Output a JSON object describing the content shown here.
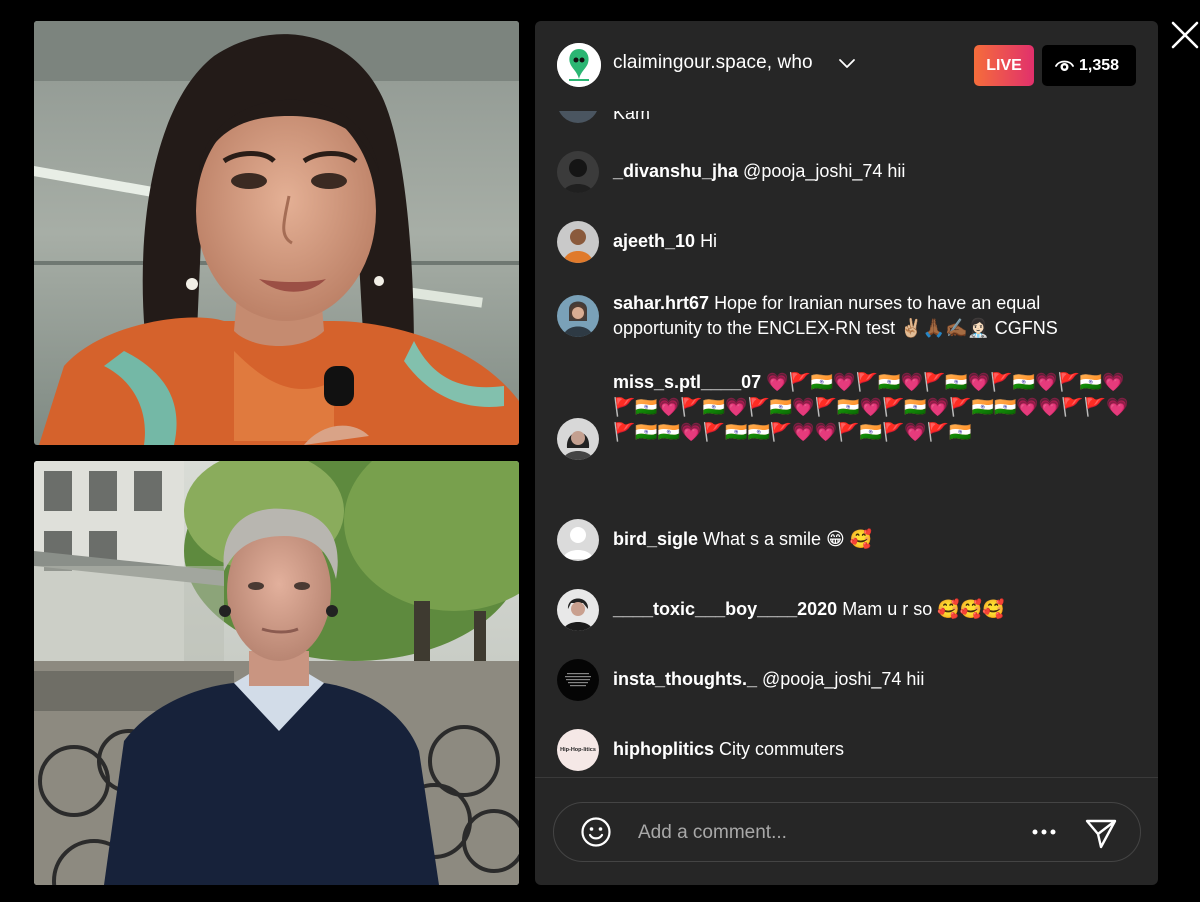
{
  "host": {
    "name": "claimingour.space, who",
    "live_label": "LIVE",
    "viewers": "1,358"
  },
  "partial_comment_text": "Kam",
  "comments": [
    {
      "user": "_divanshu_jha",
      "text": "@pooja_joshi_74 hii"
    },
    {
      "user": "ajeeth_10",
      "text": "Hi"
    },
    {
      "user": "sahar.hrt67",
      "text": "Hope for Iranian nurses to have an equal opportunity to the ENCLEX-RN test ✌🏼🙏🏾✍🏾👩🏻‍⚕️ CGFNS"
    },
    {
      "user": "miss_s.ptl____07",
      "text": "💗🚩🇮🇳💗🚩🇮🇳💗🚩🇮🇳💗🚩🇮🇳💗🚩🇮🇳💗🚩🇮🇳💗🚩🇮🇳💗🚩🇮🇳💗🚩🇮🇳💗🚩🇮🇳💗🚩🇮🇳🇮🇳💗💗🚩🚩💗🚩🇮🇳🇮🇳💗🚩🇮🇳🇮🇳🚩💗💗🚩🇮🇳🚩💗🚩🇮🇳"
    },
    {
      "user": "bird_sigle",
      "text": "What s a smile 😁 🥰"
    },
    {
      "user": "____toxic___boy____2020",
      "text": "Mam u r so 🥰🥰🥰"
    },
    {
      "user": "insta_thoughts._",
      "text": "@pooja_joshi_74 hii"
    },
    {
      "user": "hiphoplitics",
      "text": "City commuters"
    }
  ],
  "avatars": {
    "hiphoplitics_text": "Hip-Hop-litics"
  },
  "input": {
    "placeholder": "Add a comment..."
  },
  "icons": {
    "close": "close-icon",
    "chevron": "chevron-down-icon",
    "eye": "eye-icon",
    "emoji": "emoji-icon",
    "more": "more-icon",
    "send": "send-icon"
  },
  "colors": {
    "panel_bg": "#262626",
    "live_gradient_start": "#f56d3b",
    "live_gradient_end": "#e1306c",
    "page_bg": "#000000"
  }
}
